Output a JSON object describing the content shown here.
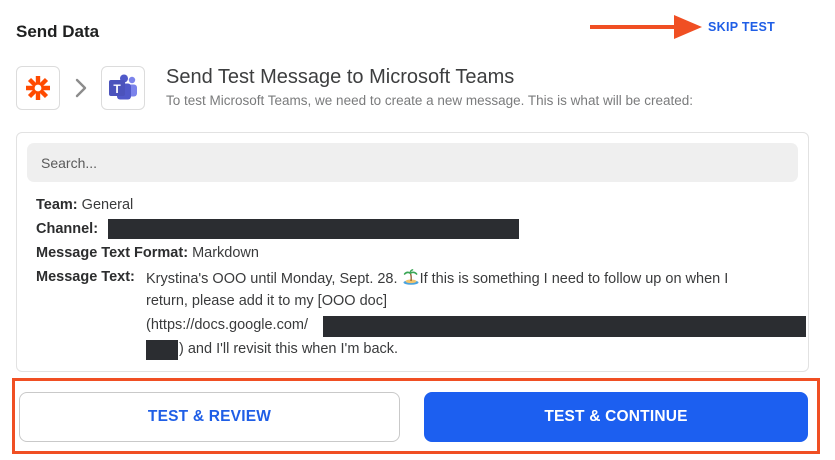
{
  "header": {
    "section_title": "Send Data",
    "skip_label": "SKIP TEST"
  },
  "step": {
    "title": "Send Test Message to Microsoft Teams",
    "subtitle": "To test Microsoft Teams, we need to create a new message. This is what will be created:",
    "source_app_icon": "zapier-icon",
    "target_app_icon": "microsoft-teams-icon",
    "separator_icon": "chevron-right-icon"
  },
  "search": {
    "placeholder": "Search..."
  },
  "fields": {
    "team_label": "Team:",
    "team_value": "General",
    "channel_label": "Channel:",
    "format_label": "Message Text Format:",
    "format_value": "Markdown",
    "message_label": "Message Text:",
    "message_line1_a": "Krystina's OOO until Monday, Sept. 28.",
    "message_line1_b": "If this is something I need to follow up on when I",
    "message_line2": "return, please add it to my [OOO doc]",
    "message_line3": "(https://docs.google.com/",
    "message_line4": ") and I'll revisit this when I'm back."
  },
  "buttons": {
    "review_label": "TEST & REVIEW",
    "continue_label": "TEST & CONTINUE"
  },
  "colors": {
    "accent_blue": "#1c5ff0",
    "link_blue": "#1f5ee6",
    "annotation_orange": "#f04f23",
    "zapier_orange": "#ff4a00",
    "teams_purple": "#5059c9",
    "redaction": "#2b2d31"
  }
}
